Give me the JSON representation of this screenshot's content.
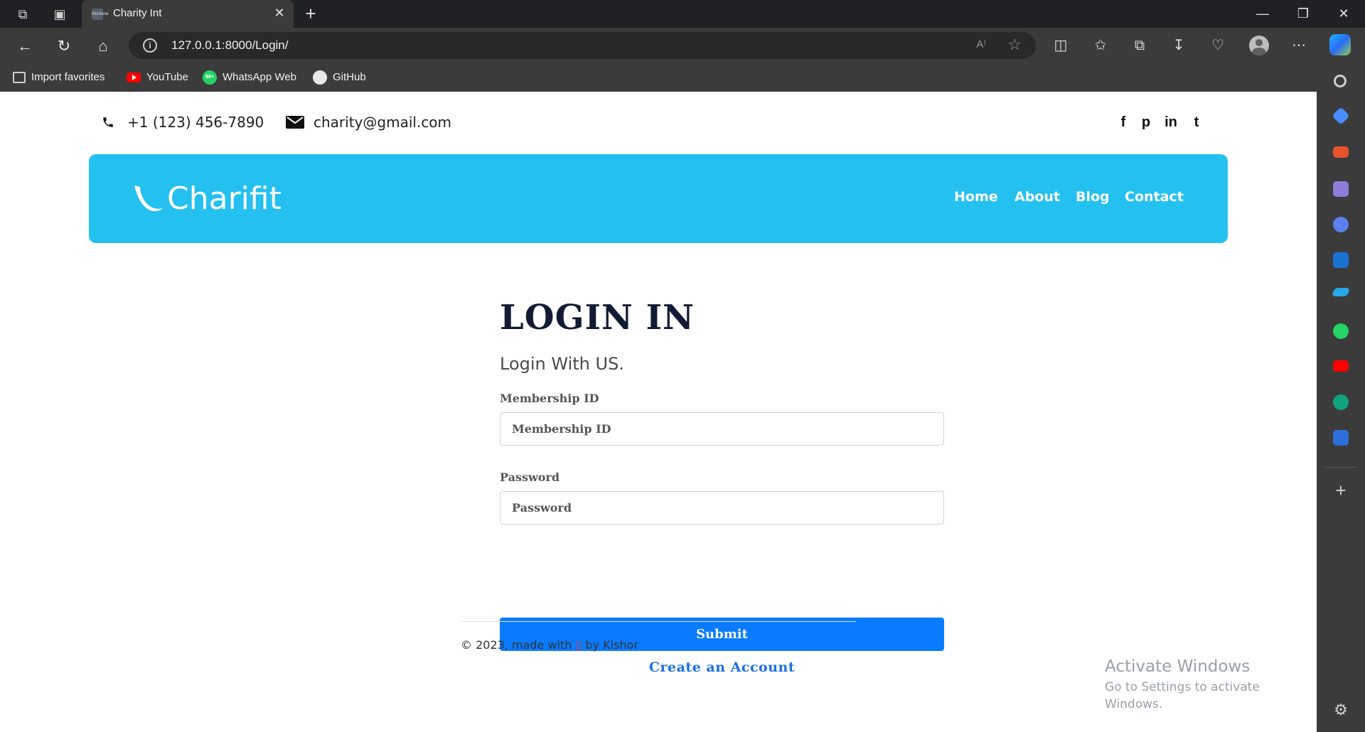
{
  "browser": {
    "tab_title": "Charity Int",
    "tab_favicon_text": "Montana",
    "url": "127.0.0.1:8000/Login/",
    "read_aloud": "A⁾",
    "bookmarks": [
      "Import favorites",
      "YouTube",
      "WhatsApp Web",
      "GitHub"
    ],
    "whatsapp_badge": "99+"
  },
  "site": {
    "phone": "+1 (123) 456-7890",
    "email": "charity@gmail.com",
    "social": [
      "f",
      "p",
      "in",
      "t"
    ],
    "brand": "Charifit",
    "nav": [
      "Home",
      "About",
      "Blog",
      "Contact"
    ],
    "brand_color": "#24c0ef"
  },
  "login": {
    "title": "LOGIN IN",
    "subtitle": "Login With US.",
    "membership_label": "Membership ID",
    "membership_placeholder": "Membership ID",
    "password_label": "Password",
    "password_placeholder": "Password",
    "submit": "Submit",
    "create_account": "Create an Account",
    "button_color": "#0a7bff"
  },
  "footer": {
    "prefix": "© 2023, made with",
    "heart": "▯",
    "suffix": "by Kishor"
  },
  "watermark": {
    "line1": "Activate Windows",
    "line2": "Go to Settings to activate Windows."
  },
  "icons": {
    "sidebar": [
      "search-icon",
      "tag-icon",
      "briefcase-icon",
      "games-icon",
      "copilot-icon",
      "outlook-icon",
      "send-icon",
      "whatsapp-icon",
      "youtube-icon",
      "chatgpt-icon",
      "translate-icon"
    ]
  }
}
